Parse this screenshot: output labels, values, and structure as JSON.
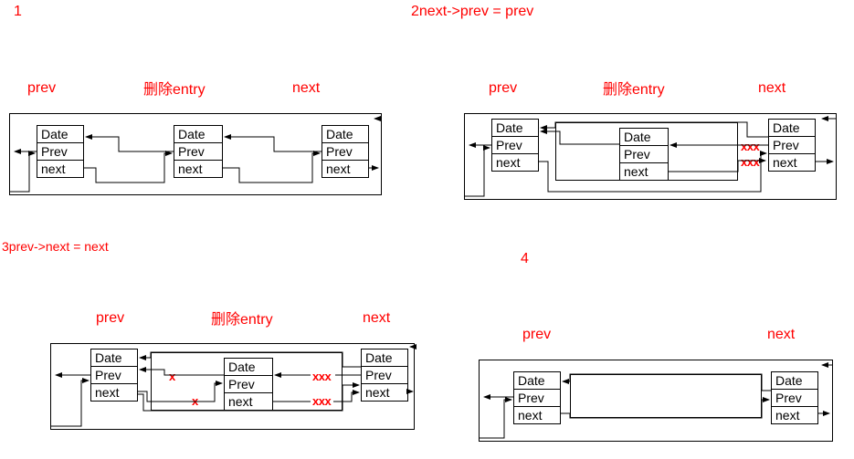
{
  "titles": {
    "t1": "1",
    "t2": "2next->prev = prev",
    "t3": "3prev->next = next",
    "t4": "4"
  },
  "labels": {
    "prev": "prev",
    "delEntry": "删除entry",
    "next": "next"
  },
  "fields": {
    "date": "Date",
    "prev": "Prev",
    "next": "next"
  },
  "marks": {
    "xxx": "xxx",
    "x": "x"
  }
}
